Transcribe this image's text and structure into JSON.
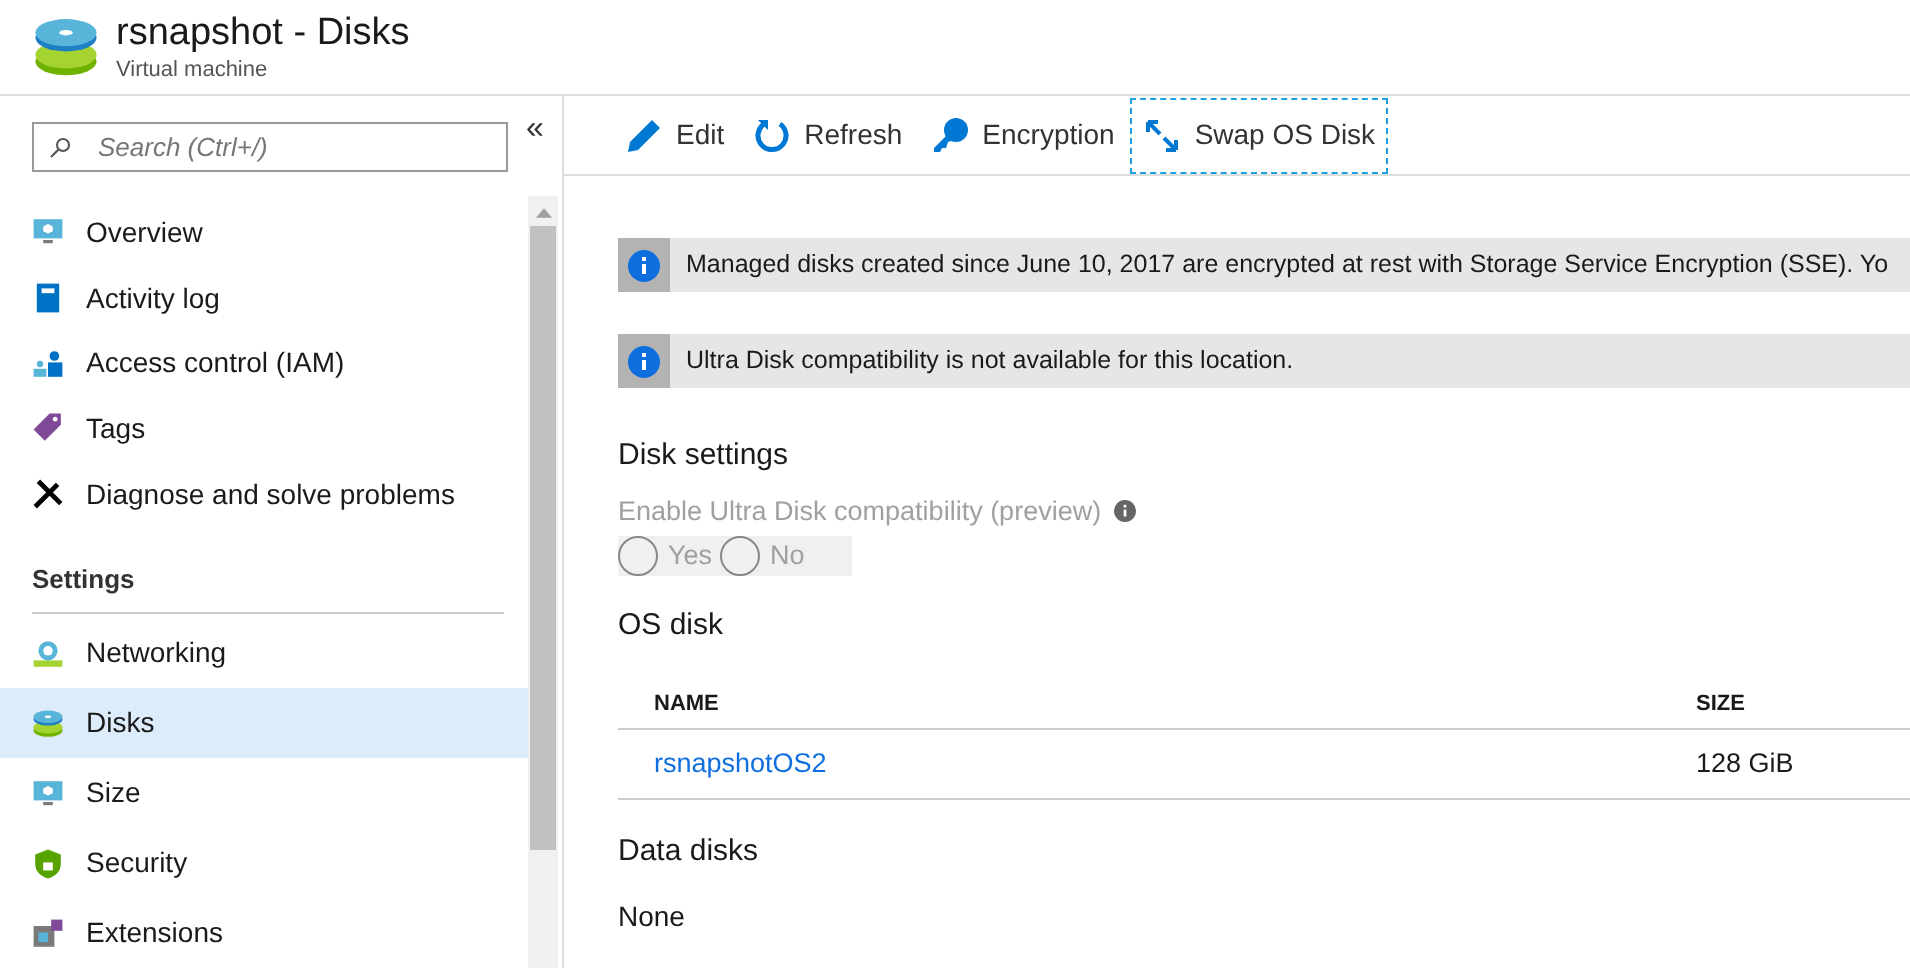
{
  "header": {
    "title": "rsnapshot - Disks",
    "subtitle": "Virtual machine"
  },
  "sidebar": {
    "search": {
      "placeholder": "Search (Ctrl+/)"
    },
    "collapse": "«",
    "items": [
      {
        "label": "Overview",
        "selected": false
      },
      {
        "label": "Activity log",
        "selected": false
      },
      {
        "label": "Access control (IAM)",
        "selected": false
      },
      {
        "label": "Tags",
        "selected": false
      },
      {
        "label": "Diagnose and solve problems",
        "selected": false
      }
    ],
    "sections": [
      {
        "title": "Settings",
        "items": [
          {
            "label": "Networking",
            "selected": false
          },
          {
            "label": "Disks",
            "selected": true
          },
          {
            "label": "Size",
            "selected": false
          },
          {
            "label": "Security",
            "selected": false
          },
          {
            "label": "Extensions",
            "selected": false
          }
        ]
      }
    ]
  },
  "toolbar": [
    {
      "label": "Edit",
      "focused": false
    },
    {
      "label": "Refresh",
      "focused": false
    },
    {
      "label": "Encryption",
      "focused": false
    },
    {
      "label": "Swap OS Disk",
      "focused": true
    }
  ],
  "banners": [
    "Managed disks created since June 10, 2017 are encrypted at rest with Storage Service Encryption (SSE). Yo",
    "Ultra Disk compatibility is not available for this location."
  ],
  "disk_settings": {
    "title": "Disk settings",
    "label": "Enable Ultra Disk compatibility (preview)",
    "disabled": true,
    "options": [
      {
        "label": "Yes",
        "selected": false
      },
      {
        "label": "No",
        "selected": false
      }
    ]
  },
  "os_disk": {
    "title": "OS disk",
    "columns": [
      "NAME",
      "SIZE"
    ],
    "rows": [
      [
        "rsnapshotOS2",
        "128 GiB"
      ]
    ]
  },
  "data_disks": {
    "title": "Data disks",
    "value": "None"
  }
}
